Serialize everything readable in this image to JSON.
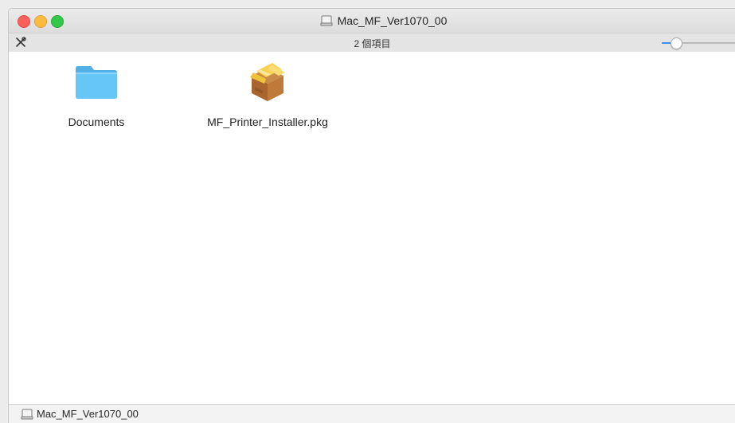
{
  "window": {
    "title": "Mac_MF_Ver1070_00"
  },
  "toolbar": {
    "item_count": "2 個項目",
    "tools_icon": "action-tools-icon"
  },
  "files": [
    {
      "name": "Documents",
      "icon": "folder-icon"
    },
    {
      "name": "MF_Printer_Installer.pkg",
      "icon": "package-icon"
    }
  ],
  "pathbar": {
    "path": "Mac_MF_Ver1070_00",
    "icon": "disk-icon"
  },
  "colors": {
    "close": "#fc605c",
    "minimize": "#fdbc40",
    "maximize": "#34c84a",
    "folder": "#5ec2f3",
    "slider_accent": "#3b8cf5"
  }
}
